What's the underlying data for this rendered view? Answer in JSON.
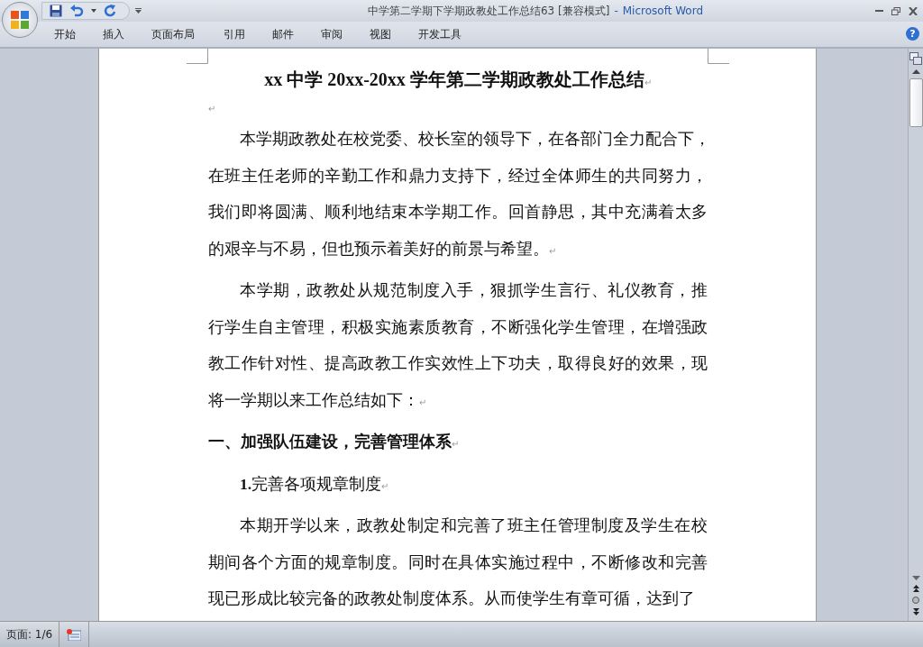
{
  "window": {
    "title_document": "中学第二学期下学期政教处工作总结63 [兼容模式]",
    "title_separator": "-",
    "title_app": "Microsoft Word"
  },
  "ribbon_tabs": [
    "开始",
    "插入",
    "页面布局",
    "引用",
    "邮件",
    "审阅",
    "视图",
    "开发工具"
  ],
  "help_glyph": "?",
  "document": {
    "title": "xx 中学 20xx-20xx 学年第二学期政教处工作总结",
    "paragraph_mark": "↵",
    "blocks": [
      {
        "kind": "empty"
      },
      {
        "kind": "body",
        "lines": [
          "本学期政教处在校党委、校长室的领导下，在各部门全力配合下，",
          "在班主任老师的辛勤工作和鼎力支持下，经过全体师生的共同努力，",
          "我们即将圆满、顺利地结束本学期工作。回首静思，其中充满着太多",
          "的艰辛与不易，但也预示着美好的前景与希望。"
        ],
        "ends": true
      },
      {
        "kind": "body",
        "lines": [
          "本学期，政教处从规范制度入手，狠抓学生言行、礼仪教育，推",
          "行学生自主管理，积极实施素质教育，不断强化学生管理，在增强政",
          "教工作针对性、提高政教工作实效性上下功夫，取得良好的效果，现",
          "将一学期以来工作总结如下："
        ],
        "ends": true
      },
      {
        "kind": "heading",
        "lines": [
          "一、加强队伍建设，完善管理体系"
        ],
        "ends": true
      },
      {
        "kind": "subheading",
        "lines": [
          "**1.**完善各项规章制度"
        ],
        "ends": true
      },
      {
        "kind": "body",
        "lines": [
          "本期开学以来，政教处制定和完善了班主任管理制度及学生在校",
          "期间各个方面的规章制度。同时在具体实施过程中，不断修改和完善",
          "现已形成比较完备的政教处制度体系。从而使学生有章可循，达到了"
        ],
        "ends": false
      }
    ]
  },
  "status_bar": {
    "page": "页面: 1/6"
  }
}
